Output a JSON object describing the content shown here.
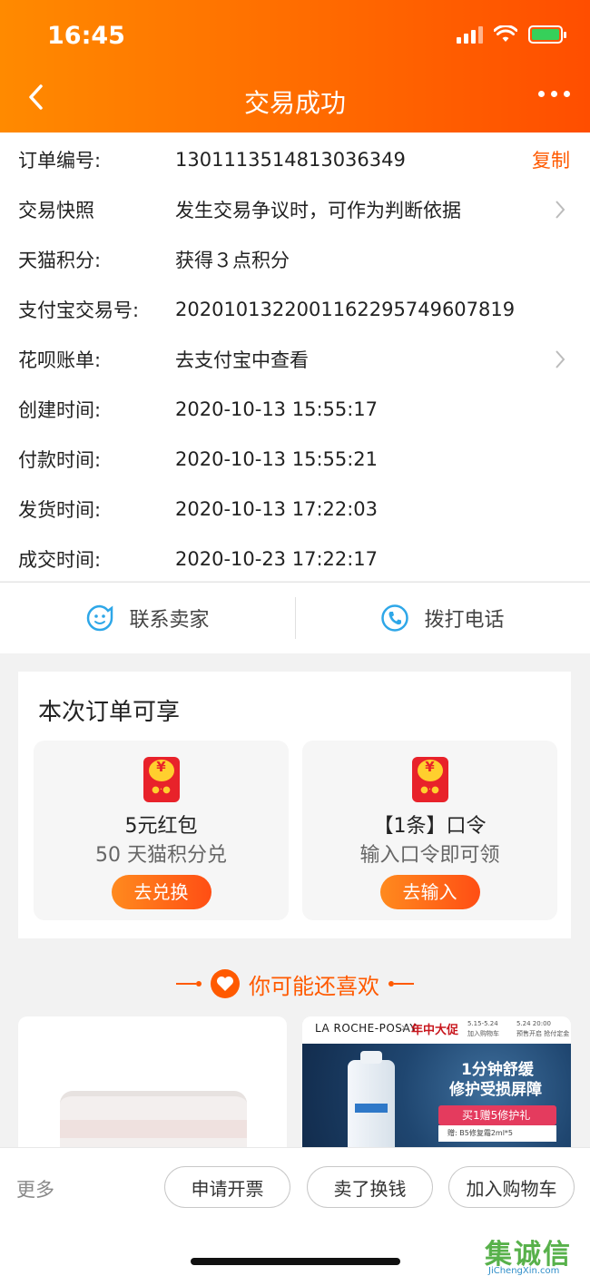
{
  "status_bar": {
    "time": "16:45"
  },
  "header": {
    "title": "交易成功"
  },
  "info_rows": [
    {
      "label": "订单编号:",
      "value": "1301113514813036349",
      "action": "复制"
    },
    {
      "label": "交易快照",
      "value": "发生交易争议时，可作为判断依据"
    },
    {
      "label": "天猫积分:",
      "value": "获得３点积分"
    },
    {
      "label": "支付宝交易号:",
      "value": "2020101322001162295749607819"
    },
    {
      "label": "花呗账单:",
      "value": "去支付宝中查看"
    },
    {
      "label": "创建时间:",
      "value": "2020-10-13 15:55:17"
    },
    {
      "label": "付款时间:",
      "value": "2020-10-13 15:55:21"
    },
    {
      "label": "发货时间:",
      "value": "2020-10-13 17:22:03"
    },
    {
      "label": "成交时间:",
      "value": "2020-10-23 17:22:17"
    }
  ],
  "contact": {
    "seller_label": "联系卖家",
    "phone_label": "拨打电话"
  },
  "benefits": {
    "title": "本次订单可享",
    "items": [
      {
        "name": "5元红包",
        "desc": "50 天猫积分兑",
        "button": "去兑换"
      },
      {
        "name": "【1条】口令",
        "desc": "输入口令即可领",
        "button": "去输入"
      }
    ]
  },
  "recommend": {
    "title": "你可能还喜欢",
    "ad": {
      "brand": "LA ROCHE-POSAY",
      "sale": "年中大促",
      "date1": "5.15-5.24",
      "date1_sub": "加入购物车",
      "date2": "5.24 20:00",
      "date2_sub": "预售开启 抢付定金",
      "headline1": "1分钟舒缓",
      "headline2": "修护受损屏障",
      "gift": "买1赠5修护礼",
      "gift_note": "赠: B5修复霜2ml*5"
    }
  },
  "bottom_bar": {
    "more": "更多",
    "buttons": [
      "申请开票",
      "卖了换钱",
      "加入购物车"
    ]
  },
  "watermark": {
    "cn": "集诚信",
    "en": "JiChengXin.com"
  },
  "colors": {
    "accent": "#ff5a00",
    "header_start": "#ff8a00",
    "header_end": "#ff4e00"
  }
}
